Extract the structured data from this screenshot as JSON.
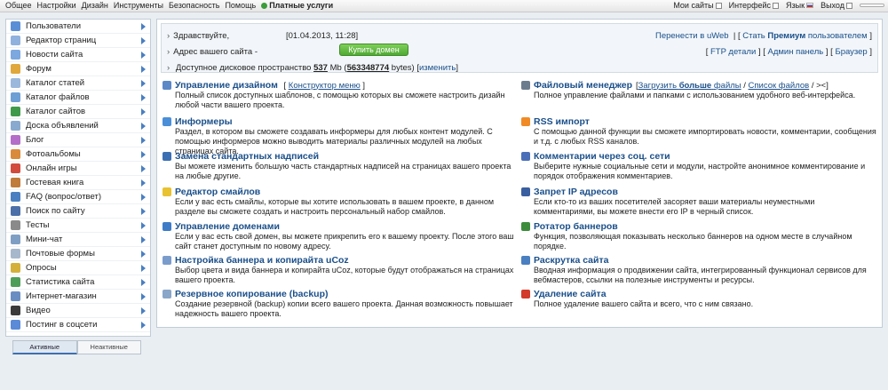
{
  "topbar": {
    "menu": [
      "Общее",
      "Настройки",
      "Дизайн",
      "Инструменты",
      "Безопасность",
      "Помощь"
    ],
    "paid": "Платные услуги",
    "my_sites": "Мои сайты",
    "interface": "Интерфейс",
    "language": "Язык",
    "logout": "Выход"
  },
  "sidebar": {
    "items": [
      {
        "label": "Пользователи",
        "icon": "users-icon",
        "color": "#5a8fd6"
      },
      {
        "label": "Редактор страниц",
        "icon": "page-editor-icon",
        "color": "#8fb1dd"
      },
      {
        "label": "Новости сайта",
        "icon": "news-icon",
        "color": "#7ca7df"
      },
      {
        "label": "Форум",
        "icon": "forum-icon",
        "color": "#e0a83a"
      },
      {
        "label": "Каталог статей",
        "icon": "articles-icon",
        "color": "#9ab8dc"
      },
      {
        "label": "Каталог файлов",
        "icon": "files-icon",
        "color": "#6e9fd4"
      },
      {
        "label": "Каталог сайтов",
        "icon": "sites-icon",
        "color": "#3f9b4a"
      },
      {
        "label": "Доска объявлений",
        "icon": "board-icon",
        "color": "#89a9cf"
      },
      {
        "label": "Блог",
        "icon": "blog-icon",
        "color": "#b46dc9"
      },
      {
        "label": "Фотоальбомы",
        "icon": "photo-icon",
        "color": "#d98a3a"
      },
      {
        "label": "Онлайн игры",
        "icon": "games-icon",
        "color": "#d24a3c"
      },
      {
        "label": "Гостевая книга",
        "icon": "guestbook-icon",
        "color": "#c07a3a"
      },
      {
        "label": "FAQ (вопрос/ответ)",
        "icon": "faq-icon",
        "color": "#4a7fc1"
      },
      {
        "label": "Поиск по сайту",
        "icon": "search-icon",
        "color": "#4b6fa8"
      },
      {
        "label": "Тесты",
        "icon": "tests-icon",
        "color": "#8a8a8a"
      },
      {
        "label": "Мини-чат",
        "icon": "chat-icon",
        "color": "#7f9ec4"
      },
      {
        "label": "Почтовые формы",
        "icon": "mail-icon",
        "color": "#a8b8cc"
      },
      {
        "label": "Опросы",
        "icon": "polls-icon",
        "color": "#d4b03a"
      },
      {
        "label": "Статистика сайта",
        "icon": "stats-icon",
        "color": "#4e9e5a"
      },
      {
        "label": "Интернет-магазин",
        "icon": "shop-icon",
        "color": "#6b8ec2"
      },
      {
        "label": "Видео",
        "icon": "video-icon",
        "color": "#3a3a3a"
      },
      {
        "label": "Постинг в соцсети",
        "icon": "social-icon",
        "color": "#5a8ad8"
      }
    ],
    "tab_active": "Активные",
    "tab_inactive": "Неактивные"
  },
  "info": {
    "greeting": "Здравствуйте,",
    "date": "[01.04.2013, 11:28]",
    "site_address": "Адрес вашего сайта -",
    "buy_domain": "Купить домен",
    "move_uweb": "Перенести в uWeb",
    "premium_prefix": "Стать",
    "premium": "Премиум",
    "premium_suffix": "пользователем",
    "ftp": "FTP детали",
    "admin": "Админ панель",
    "browser": "Браузер",
    "disk_label": "Доступное дисковое пространство",
    "disk_mb": "537",
    "disk_mb_unit": "Mb",
    "disk_bytes": "563348774",
    "disk_bytes_unit": "bytes",
    "change": "изменить"
  },
  "modules_left": [
    {
      "title": "Управление дизайном",
      "extra": "Конструктор меню",
      "desc": "Полный список доступных шаблонов, с помощью которых вы сможете настроить дизайн любой части вашего проекта.",
      "icon": "design-icon",
      "color": "#5b88c6"
    },
    {
      "title": "Информеры",
      "desc": "Раздел, в котором вы сможете создавать информеры для любых контент модулей. С помощью информеров можно выводить материалы различных модулей на любых страницах сайта.",
      "icon": "informer-icon",
      "color": "#4a8fd8"
    },
    {
      "title": "Замена стандартных надписей",
      "desc": "Вы можете изменить большую часть стандартных надписей на страницах вашего проекта на любые другие.",
      "icon": "text-icon",
      "color": "#3b6fb3"
    },
    {
      "title": "Редактор смайлов",
      "desc": "Если у вас есть смайлы, которые вы хотите использовать в вашем проекте, в данном разделе вы сможете создать и настроить персональный набор смайлов.",
      "icon": "smile-icon",
      "color": "#e8c230"
    },
    {
      "title": "Управление доменами",
      "desc": "Если у вас есть свой домен, вы можете прикрепить его к вашему проекту. После этого ваш сайт станет доступным по новому адресу.",
      "icon": "domain-icon",
      "color": "#3e7cc8"
    },
    {
      "title": "Настройка баннера и копирайта uCoz",
      "desc": "Выбор цвета и вида баннера и копирайта uCoz, которые будут отображаться на страницах вашего проекта.",
      "icon": "banner-icon",
      "color": "#7a9ccc"
    },
    {
      "title": "Резервное копирование (backup)",
      "desc": "Создание резервной (backup) копии всего вашего проекта. Данная возможность повышает надежность вашего проекта.",
      "icon": "backup-icon",
      "color": "#8aa6c8"
    }
  ],
  "modules_right": [
    {
      "title": "Файловый менеджер",
      "extra_open": "[",
      "extra_a": "Загрузить",
      "extra_b": "больше",
      "extra_c": "файлы",
      "extra_sep": " / ",
      "extra_d": "Список файлов",
      "extra_close": " / ><]",
      "desc": "Полное управление файлами и папками с использованием удобного веб-интерфейса.",
      "icon": "filemanager-icon",
      "color": "#6b7c8e"
    },
    {
      "title": "RSS импорт",
      "desc": "С помощью данной функции вы сможете импортировать новости, комментарии, сообщения и т.д. с любых RSS каналов.",
      "icon": "rss-icon",
      "color": "#f08a24"
    },
    {
      "title": "Комментарии через соц. сети",
      "desc": "Выберите нужные социальные сети и модули, настройте анонимное комментирование и порядок отображения комментариев.",
      "icon": "social-comments-icon",
      "color": "#4a6fb8"
    },
    {
      "title": "Запрет IP адресов",
      "desc": "Если кто-то из ваших посетителей засоряет ваши материалы неуместными комментариями, вы можете внести его IP в черный список.",
      "icon": "ip-ban-icon",
      "color": "#3a5fa0"
    },
    {
      "title": "Ротатор баннеров",
      "desc": "Функция, позволяющая показывать несколько баннеров на одном месте в случайном порядке.",
      "icon": "rotator-icon",
      "color": "#3c8c3c"
    },
    {
      "title": "Раскрутка сайта",
      "desc": "Вводная информация о продвижении сайта, интегрированный функционал сервисов для вебмастеров, ссылки на полезные инструменты и ресурсы.",
      "icon": "promo-icon",
      "color": "#4a7fc1"
    },
    {
      "title": "Удаление сайта",
      "desc": "Полное удаление вашего сайта и всего, что с ним связано.",
      "icon": "delete-icon",
      "color": "#d23a2a"
    }
  ]
}
